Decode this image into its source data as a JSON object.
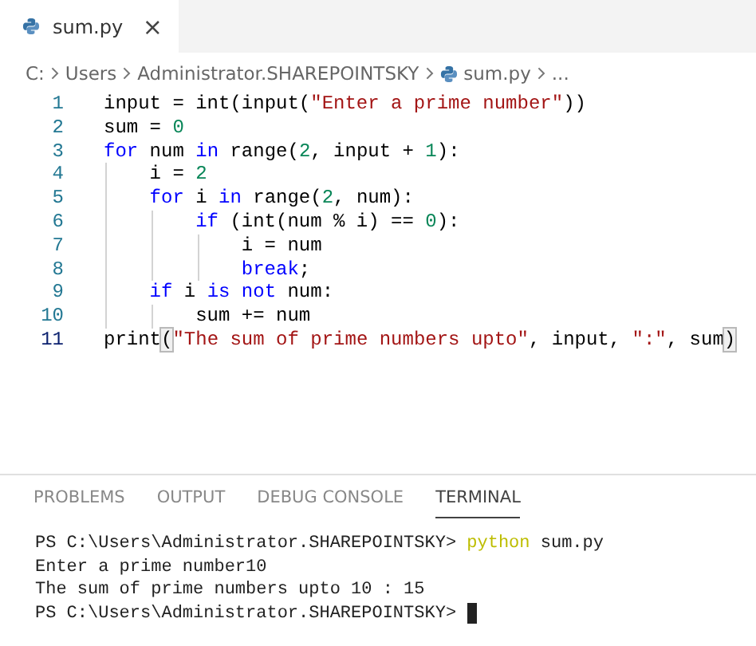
{
  "tabs": [
    {
      "label": "sum.py",
      "selected": true,
      "close": "×"
    }
  ],
  "breadcrumb": [
    {
      "label": "C:",
      "kind": "text"
    },
    {
      "label": "Users",
      "kind": "text"
    },
    {
      "label": "Administrator.SHAREPOINTSKY",
      "kind": "text"
    },
    {
      "label": "sum.py",
      "kind": "file"
    },
    {
      "label": "...",
      "kind": "text"
    }
  ],
  "code": [
    {
      "number": "1",
      "tokens": [
        {
          "kind": "plain",
          "text": "input = int(input("
        },
        {
          "kind": "string",
          "text": "\"Enter a prime number\""
        },
        {
          "kind": "plain",
          "text": "))"
        }
      ]
    },
    {
      "number": "2",
      "tokens": [
        {
          "kind": "plain",
          "text": "sum = "
        },
        {
          "kind": "number",
          "text": "0"
        }
      ]
    },
    {
      "number": "3",
      "tokens": [
        {
          "kind": "keyword",
          "text": "for"
        },
        {
          "kind": "plain",
          "text": " num "
        },
        {
          "kind": "keyword",
          "text": "in"
        },
        {
          "kind": "plain",
          "text": " range("
        },
        {
          "kind": "number",
          "text": "2"
        },
        {
          "kind": "plain",
          "text": ", input + "
        },
        {
          "kind": "number",
          "text": "1"
        },
        {
          "kind": "plain",
          "text": "):"
        }
      ],
      "children": [
        {
          "number": "4",
          "tokens": [
            {
              "kind": "plain",
              "text": "i = "
            },
            {
              "kind": "number",
              "text": "2"
            }
          ]
        },
        {
          "number": "5",
          "tokens": [
            {
              "kind": "keyword",
              "text": "for"
            },
            {
              "kind": "plain",
              "text": " i "
            },
            {
              "kind": "keyword",
              "text": "in"
            },
            {
              "kind": "plain",
              "text": " range("
            },
            {
              "kind": "number",
              "text": "2"
            },
            {
              "kind": "plain",
              "text": ", num):"
            }
          ],
          "children": [
            {
              "number": "6",
              "tokens": [
                {
                  "kind": "keyword",
                  "text": "if"
                },
                {
                  "kind": "plain",
                  "text": " (int(num % i) == "
                },
                {
                  "kind": "number",
                  "text": "0"
                },
                {
                  "kind": "plain",
                  "text": "):"
                }
              ],
              "children": [
                {
                  "number": "7",
                  "tokens": [
                    {
                      "kind": "plain",
                      "text": "i = num"
                    }
                  ]
                },
                {
                  "number": "8",
                  "tokens": [
                    {
                      "kind": "keyword",
                      "text": "break"
                    },
                    {
                      "kind": "plain",
                      "text": ";"
                    }
                  ]
                }
              ]
            }
          ]
        },
        {
          "number": "9",
          "tokens": [
            {
              "kind": "keyword",
              "text": "if"
            },
            {
              "kind": "plain",
              "text": " i "
            },
            {
              "kind": "keyword",
              "text": "is not"
            },
            {
              "kind": "plain",
              "text": " num:"
            }
          ],
          "children": [
            {
              "number": "10",
              "tokens": [
                {
                  "kind": "plain",
                  "text": "sum += num"
                }
              ]
            }
          ]
        }
      ]
    },
    {
      "number": "11",
      "tokens": [
        {
          "kind": "plain",
          "text": "print"
        },
        {
          "kind": "bracket",
          "text": "("
        },
        {
          "kind": "string",
          "text": "\"The sum of prime numbers upto\""
        },
        {
          "kind": "plain",
          "text": ", input, "
        },
        {
          "kind": "string",
          "text": "\":\""
        },
        {
          "kind": "plain",
          "text": ", sum"
        },
        {
          "kind": "bracket",
          "text": ")"
        }
      ]
    }
  ],
  "panel_tabs": [
    {
      "label": "PROBLEMS",
      "selected": false
    },
    {
      "label": "OUTPUT",
      "selected": false
    },
    {
      "label": "DEBUG CONSOLE",
      "selected": false
    },
    {
      "label": "TERMINAL",
      "selected": true
    }
  ],
  "terminal": [
    {
      "tokens": [
        {
          "kind": "plain",
          "text": "PS C:\\Users\\Administrator.SHAREPOINTSKY> "
        },
        {
          "kind": "command",
          "text": "python"
        },
        {
          "kind": "plain",
          "text": " sum.py"
        }
      ],
      "cursor": false
    },
    {
      "tokens": [
        {
          "kind": "plain",
          "text": "Enter a prime number10"
        }
      ],
      "cursor": false
    },
    {
      "tokens": [
        {
          "kind": "plain",
          "text": "The sum of prime numbers upto 10 : 15"
        }
      ],
      "cursor": false
    },
    {
      "tokens": [
        {
          "kind": "plain",
          "text": "PS C:\\Users\\Administrator.SHAREPOINTSKY> "
        }
      ],
      "cursor": true
    }
  ]
}
